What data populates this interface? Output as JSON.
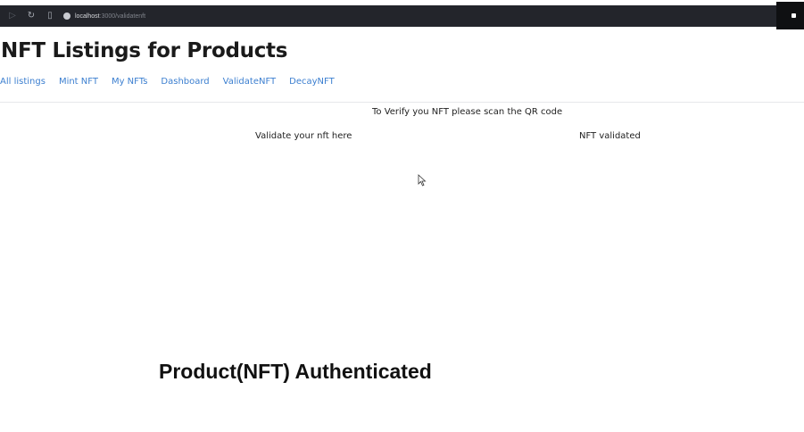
{
  "browser": {
    "url_host": "localhost",
    "url_path": ":3000/validatenft"
  },
  "page": {
    "title": "NFT Listings for Products"
  },
  "nav": {
    "items": [
      "All listings",
      "Mint NFT",
      "My NFTs",
      "Dashboard",
      "ValidateNFT",
      "DecayNFT"
    ]
  },
  "main": {
    "instruction": "To Verify you NFT please scan the QR code",
    "validate_label": "Validate your nft here",
    "status_label": "NFT validated",
    "auth_message": "Product(NFT) Authenticated"
  },
  "colors": {
    "link": "#3c7fd0",
    "browser_bar": "#23252b"
  }
}
